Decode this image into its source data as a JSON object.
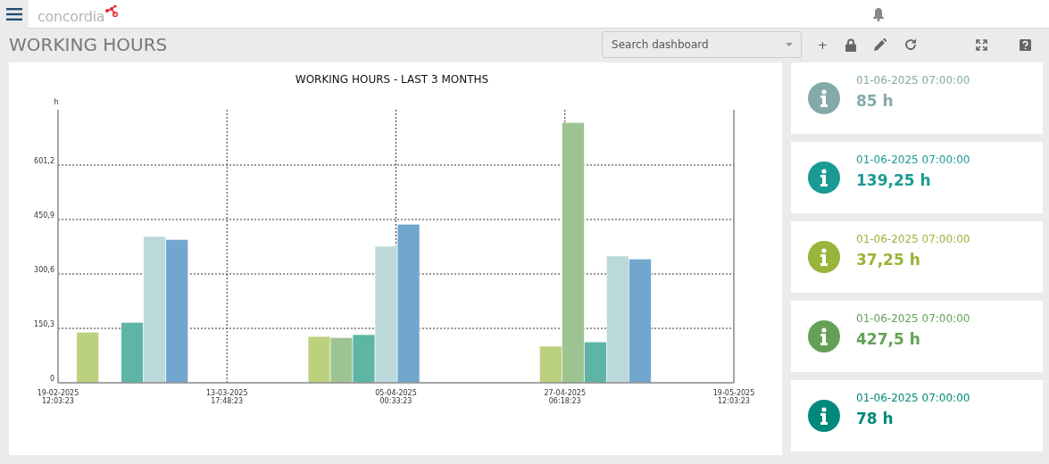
{
  "header": {
    "logo_text": "concordia"
  },
  "page_title": "WORKING HOURS",
  "search": {
    "placeholder": "Search dashboard"
  },
  "toolbar": {
    "add_label": "+"
  },
  "chart": {
    "chart_data": {
      "type": "bar",
      "title": "WORKING HOURS - LAST 3 MONTHS",
      "ylabel": "h",
      "categories": [
        null,
        null,
        null
      ],
      "ylim": [
        0,
        754
      ],
      "grid": true,
      "yticks": [
        0,
        {
          "value": 150.3,
          "label": "150,3"
        },
        {
          "value": 300.6,
          "label": "300,6"
        },
        {
          "value": 450.9,
          "label": "450,9"
        },
        {
          "value": 601.2,
          "label": "601,2"
        }
      ],
      "series": [
        {
          "color": "#bcd17e",
          "values": [
            140,
            128,
            101
          ]
        },
        {
          "color": "#9dc490",
          "values": [
            null,
            125,
            719
          ]
        },
        {
          "color": "#5db5a6",
          "values": [
            167,
            133,
            113
          ]
        },
        {
          "color": "#bbd8da",
          "values": [
            404,
            377,
            350
          ]
        },
        {
          "color": "#71a7cf",
          "values": [
            396,
            438,
            342
          ]
        }
      ]
    },
    "x_axis_labels": [
      "19-02-2025 12:03:23",
      "13-03-2025 17:48:23",
      "05-04-2025 00:33:23",
      "27-04-2025 06:18:23",
      "19-05-2025 12:03:23"
    ]
  },
  "cards": [
    {
      "timestamp": "01-06-2025 07:00:00",
      "value": "85 h",
      "color": "#84a9a8"
    },
    {
      "timestamp": "01-06-2025 07:00:00",
      "value": "139,25 h",
      "color": "#1a9a94"
    },
    {
      "timestamp": "01-06-2025 07:00:00",
      "value": "37,25 h",
      "color": "#98b43a"
    },
    {
      "timestamp": "01-06-2025 07:00:00",
      "value": "427,5 h",
      "color": "#63a157"
    },
    {
      "timestamp": "01-06-2025 07:00:00",
      "value": "78 h",
      "color": "#00897b"
    }
  ]
}
